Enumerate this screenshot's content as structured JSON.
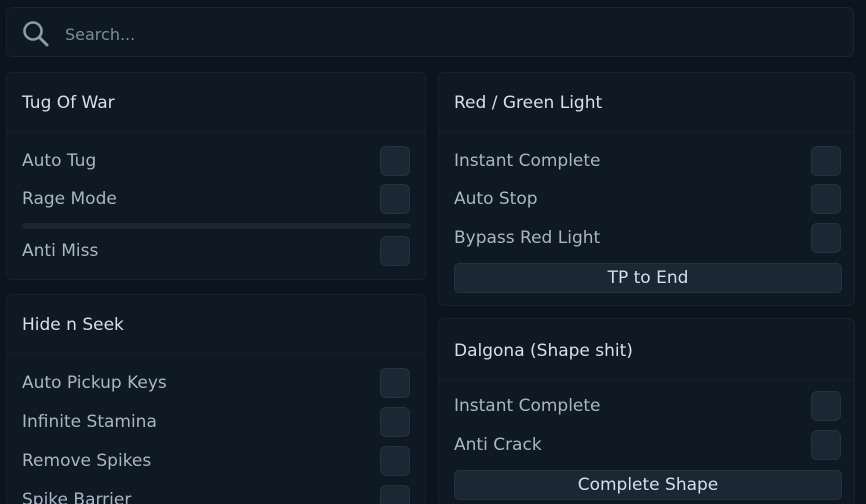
{
  "search": {
    "placeholder": "Search...",
    "icon": "search-icon"
  },
  "panels": {
    "tug_of_war": {
      "title": "Tug Of War",
      "items": [
        {
          "label": "Auto Tug",
          "enabled": false
        },
        {
          "label": "Rage Mode",
          "enabled": false
        },
        {
          "label": "Anti Miss",
          "enabled": false
        }
      ]
    },
    "red_green_light": {
      "title": "Red / Green Light",
      "items": [
        {
          "label": "Instant Complete",
          "enabled": false
        },
        {
          "label": "Auto Stop",
          "enabled": false
        },
        {
          "label": "Bypass Red Light",
          "enabled": false
        }
      ],
      "button_label": "TP to End"
    },
    "hide_n_seek": {
      "title": "Hide n Seek",
      "items": [
        {
          "label": "Auto Pickup Keys",
          "enabled": false
        },
        {
          "label": "Infinite Stamina",
          "enabled": false
        },
        {
          "label": "Remove Spikes",
          "enabled": false
        },
        {
          "label": "Spike Barrier",
          "enabled": false
        }
      ]
    },
    "dalgona": {
      "title": "Dalgona (Shape shit)",
      "items": [
        {
          "label": "Instant Complete",
          "enabled": false
        },
        {
          "label": "Anti Crack",
          "enabled": false
        }
      ],
      "button_label": "Complete Shape"
    }
  },
  "colors": {
    "background": "#0c141d",
    "panel": "#0f1924",
    "control": "#1c2734",
    "text": "#a9b6c4",
    "title_text": "#d6e0ea"
  }
}
